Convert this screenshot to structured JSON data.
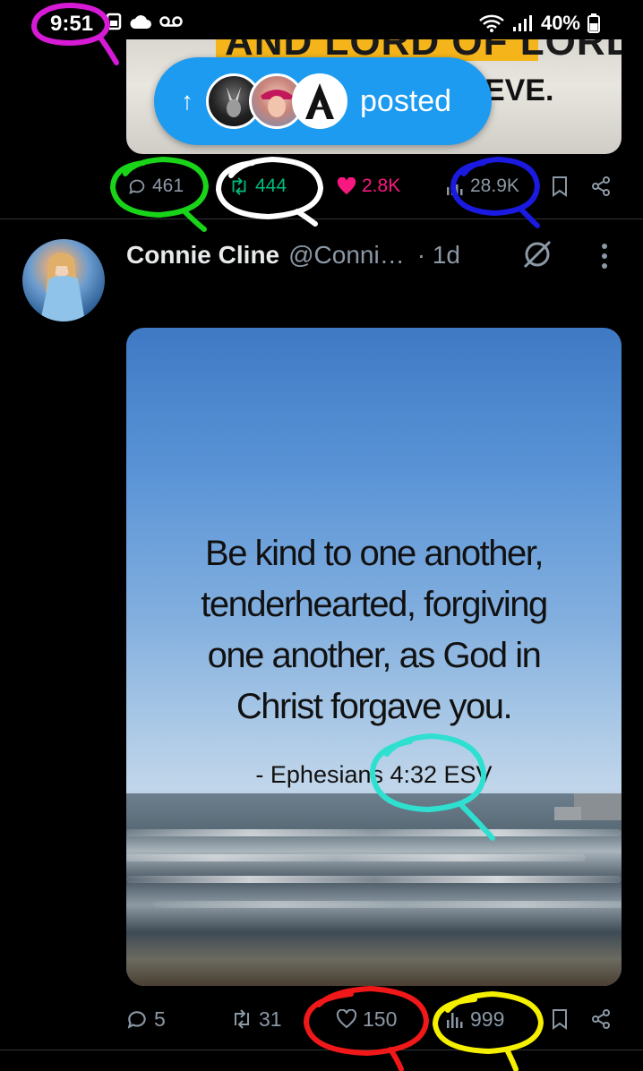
{
  "status_bar": {
    "time": "9:51",
    "battery_percent": "40%"
  },
  "previous_post": {
    "image_text_top": "AND LORD OF LORDS.",
    "image_text_fragment": "EVE.",
    "posted_pill": {
      "label": "posted"
    },
    "actions": {
      "replies": "461",
      "reposts": "444",
      "likes": "2.8K",
      "views": "28.9K"
    }
  },
  "post": {
    "author_name": "Connie Cline",
    "author_handle": "@Conni…",
    "time": "· 1d",
    "image": {
      "verse_lines": [
        "Be kind to one another,",
        "tenderhearted, forgiving",
        "one another, as God in",
        "Christ forgave you."
      ],
      "reference": "- Ephesians 4:32 ESV"
    },
    "actions": {
      "replies": "5",
      "reposts": "31",
      "likes": "150",
      "views": "999"
    }
  },
  "colors": {
    "accent": "#1d9bf0",
    "repost_active": "#00ba7c",
    "like_active": "#f91880",
    "muted": "#8b98a5",
    "annotation_magenta": "#d61ad6",
    "annotation_green": "#19d419",
    "annotation_white": "#ffffff",
    "annotation_blue": "#1a1ae0",
    "annotation_cyan": "#2fe0d0",
    "annotation_red": "#f01818",
    "annotation_yellow": "#f5f000"
  }
}
